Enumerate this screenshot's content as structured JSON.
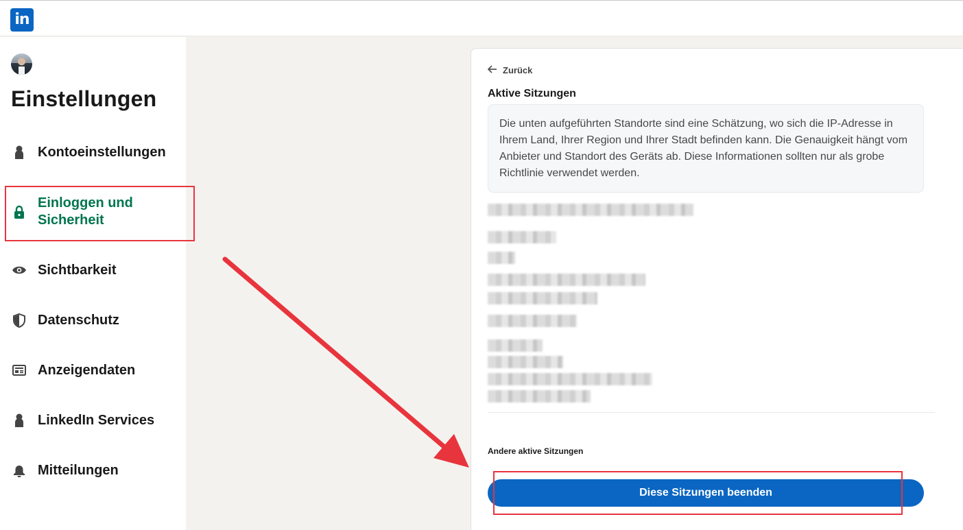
{
  "header": {
    "logo_text": "in",
    "logo_color": "#0a66c2"
  },
  "sidebar": {
    "title": "Einstellungen",
    "items": [
      {
        "label": "Kontoeinstellungen",
        "icon": "person-icon"
      },
      {
        "label": "Einloggen und Sicherheit",
        "icon": "lock-icon",
        "active": true
      },
      {
        "label": "Sichtbarkeit",
        "icon": "eye-icon"
      },
      {
        "label": "Datenschutz",
        "icon": "shield-icon"
      },
      {
        "label": "Anzeigendaten",
        "icon": "newspaper-icon"
      },
      {
        "label": "LinkedIn Services",
        "icon": "person-icon"
      },
      {
        "label": "Mitteilungen",
        "icon": "bell-icon"
      }
    ]
  },
  "main": {
    "back_label": "Zurück",
    "section_title": "Aktive Sitzungen",
    "info_text": "Die unten aufgeführten Standorte sind eine Schätzung, wo sich die IP-Adresse in Ihrem Land, Ihrer Region und Ihrer Stadt befinden kann. Die Genauigkeit hängt vom Anbieter und Standort des Geräts ab. Diese Informationen sollten nur als grobe Richtlinie verwendet werden.",
    "other_sessions_title": "Andere aktive Sitzungen",
    "end_sessions_button": "Diese Sitzungen beenden"
  },
  "colors": {
    "accent": "#0a66c2",
    "active_nav": "#01754f",
    "annotation": "#e8343d"
  }
}
